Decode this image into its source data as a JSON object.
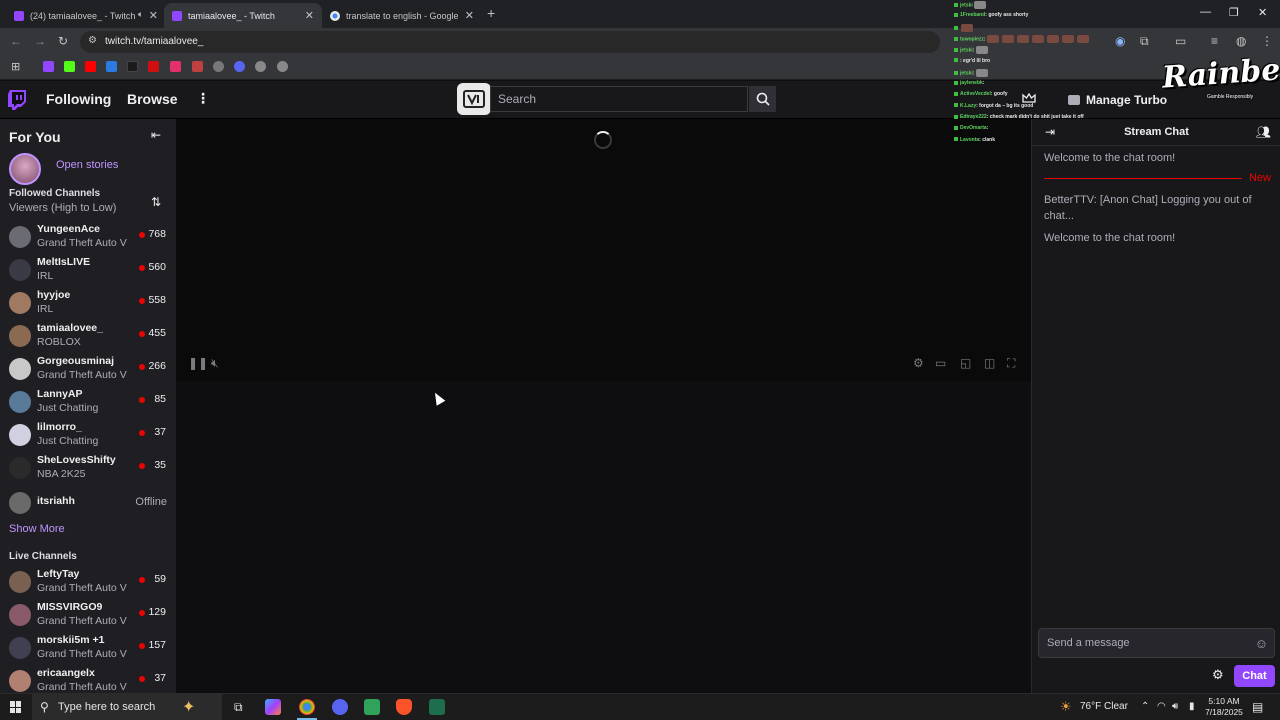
{
  "browser": {
    "tabs": [
      {
        "label": "(24) tamiaalovee_ - Twitch",
        "active": false
      },
      {
        "label": "tamiaalovee_ - Twitch",
        "active": true
      },
      {
        "label": "translate to english - Google Se",
        "active": false
      }
    ],
    "url": "twitch.tv/tamiaalovee_"
  },
  "topnav": {
    "following": "Following",
    "browse": "Browse",
    "search_placeholder": "Search",
    "turbo": "Manage Turbo"
  },
  "sidebar": {
    "title": "For You",
    "stories": "Open stories",
    "followed_header": "Followed Channels",
    "sort_label": "Viewers (High to Low)",
    "followed": [
      {
        "name": "YungeenAce",
        "game": "Grand Theft Auto V",
        "viewers": "768",
        "color": "#6b6b73"
      },
      {
        "name": "MeltIsLIVE",
        "game": "IRL",
        "viewers": "560",
        "color": "#3a3a44"
      },
      {
        "name": "hyyjoe",
        "game": "IRL",
        "viewers": "558",
        "color": "#a07a60"
      },
      {
        "name": "tamiaalovee_",
        "game": "ROBLOX",
        "viewers": "455",
        "color": "#8a6a50"
      },
      {
        "name": "Gorgeousminaj",
        "game": "Grand Theft Auto V",
        "viewers": "266",
        "color": "#c8c8c8"
      },
      {
        "name": "LannyAP",
        "game": "Just Chatting",
        "viewers": "85",
        "color": "#5a7a9a"
      },
      {
        "name": "lilmorro_",
        "game": "Just Chatting",
        "viewers": "37",
        "color": "#d0d0e0"
      },
      {
        "name": "SheLovesShifty",
        "game": "NBA 2K25",
        "viewers": "35",
        "color": "#2a2a2a"
      }
    ],
    "offline_channel": {
      "name": "itsriahh",
      "status": "Offline",
      "color": "#6a6a6a"
    },
    "show_more": "Show More",
    "live_header": "Live Channels",
    "live": [
      {
        "name": "LeftyTay",
        "game": "Grand Theft Auto V",
        "viewers": "59",
        "color": "#7a6050"
      },
      {
        "name": "MISSVIRGO9",
        "game": "Grand Theft Auto V",
        "viewers": "129",
        "color": "#8a5a6a"
      },
      {
        "name": "morskii5m +1",
        "game": "Grand Theft Auto V",
        "viewers": "157",
        "color": "#404050"
      },
      {
        "name": "ericaangelx",
        "game": "Grand Theft Auto V",
        "viewers": "37",
        "color": "#b08070"
      }
    ]
  },
  "chat": {
    "title": "Stream Chat",
    "messages": [
      "Welcome to the chat room!",
      "BetterTTV: [Anon Chat] Logging you out of chat...",
      "Welcome to the chat room!"
    ],
    "new_label": "New",
    "input_placeholder": "Send a message",
    "chat_button": "Chat"
  },
  "overlay": {
    "lines": [
      {
        "user": "jetski",
        "text": ""
      },
      {
        "user": "1Freeband",
        "text": ": goofy ass shorty"
      },
      {
        "user": "",
        "text": ""
      },
      {
        "user": "tuwopiezz",
        "text": ":"
      },
      {
        "user": "jetski",
        "text": ":"
      },
      {
        "user": "",
        "text": ": egr'd lil bro"
      },
      {
        "user": "jetski",
        "text": ":"
      },
      {
        "user": "jaylenebk",
        "text": ":"
      },
      {
        "user": "ActiveVecdel",
        "text": ": goofy"
      },
      {
        "user": "K.Lazy",
        "text": ": forgot da – bg its good"
      },
      {
        "user": "Edtrayx222",
        "text": ": check mark didn't do shit just take it off"
      },
      {
        "user": "DevOmarta",
        "text": ":"
      },
      {
        "user": "Lavonta",
        "text": ": clank"
      }
    ],
    "sponsor": "Rainbet",
    "sponsor_sub": "Gamble Responsibly"
  },
  "taskbar": {
    "search": "Type here to search",
    "weather": "76°F  Clear",
    "time": "5:10 AM",
    "date": "7/18/2025"
  }
}
